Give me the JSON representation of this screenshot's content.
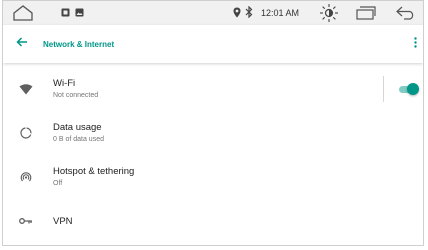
{
  "status_bar": {
    "time": "12:01 AM",
    "icons": [
      "home-icon",
      "notification-icon",
      "image-icon",
      "location-icon",
      "bluetooth-icon",
      "brightness-icon",
      "recents-icon",
      "back-icon"
    ]
  },
  "app_bar": {
    "title": "Network & Internet",
    "back_icon": "arrow-left-icon",
    "overflow_icon": "more-vert-icon"
  },
  "colors": {
    "accent": "#009688",
    "accent_light": "#80cbc4",
    "status_bar_bg": "#f1f1f1"
  },
  "settings": [
    {
      "icon": "wifi-icon",
      "label": "Wi-Fi",
      "summary": "Not connected",
      "toggle": true
    },
    {
      "icon": "data-usage-icon",
      "label": "Data usage",
      "summary": "0 B of data used"
    },
    {
      "icon": "hotspot-icon",
      "label": "Hotspot & tethering",
      "summary": "Off"
    },
    {
      "icon": "vpn-key-icon",
      "label": "VPN",
      "summary": ""
    }
  ]
}
